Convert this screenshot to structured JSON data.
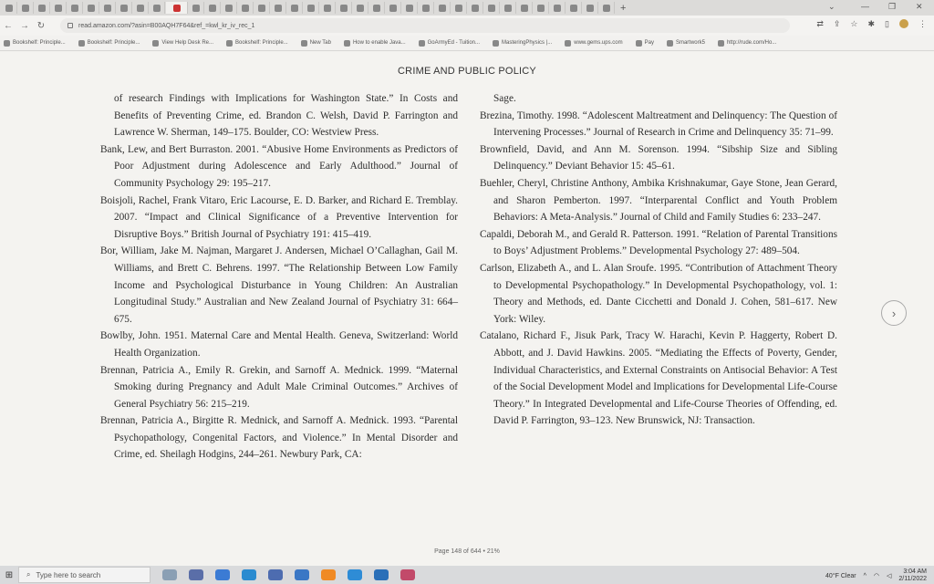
{
  "browser": {
    "tab_count": 37,
    "url": "read.amazon.com/?asin=B00AQH7F64&ref_=kwl_kr_iv_rec_1",
    "bookmarks": [
      "Bookshelf: Principle...",
      "Bookshelf: Principle...",
      "View Help Desk Re...",
      "Bookshelf: Principle...",
      "New Tab",
      "How to enable Java...",
      "GoArmyEd - Tuition...",
      "MasteringPhysics |...",
      "www.gems.ups.com",
      "Pay",
      "Smartwork5",
      "http://rude.com/Ho..."
    ]
  },
  "reader": {
    "running_head": "CRIME AND PUBLIC POLICY",
    "page_indicator": "Page 148 of 644 • 21%",
    "left_column": [
      {
        "cont": true,
        "text": "of research Findings with Implications for Washington State.” In Costs and Benefits of Preventing Crime, ed. Brandon C. Welsh, David P. Farrington and Lawrence W. Sherman, 149–175. Boulder, CO: Westview Press."
      },
      {
        "cont": false,
        "text": "Bank, Lew, and Bert Burraston. 2001. “Abusive Home Environments as Predictors of Poor Adjustment during Adolescence and Early Adulthood.” Journal of Community Psychology 29: 195–217."
      },
      {
        "cont": false,
        "text": "Boisjoli, Rachel, Frank Vitaro, Eric Lacourse, E. D. Barker, and Richard E. Tremblay. 2007. “Impact and Clinical Significance of a Preventive Intervention for Disruptive Boys.” British Journal of Psychiatry 191: 415–419."
      },
      {
        "cont": false,
        "text": "Bor, William, Jake M. Najman, Margaret J. Andersen, Michael O’Callaghan, Gail M. Williams, and Brett C. Behrens. 1997. “The Relationship Between Low Family Income and Psychological Disturbance in Young Children: An Australian Longitudinal Study.” Australian and New Zealand Journal of Psychiatry 31: 664–675."
      },
      {
        "cont": false,
        "text": "Bowlby, John. 1951. Maternal Care and Mental Health. Geneva, Switzerland: World Health Organization."
      },
      {
        "cont": false,
        "text": "Brennan, Patricia A., Emily R. Grekin, and Sarnoff A. Mednick. 1999. “Maternal Smoking during Pregnancy and Adult Male Criminal Outcomes.” Archives of General Psychiatry 56: 215–219."
      },
      {
        "cont": false,
        "text": "Brennan, Patricia A., Birgitte R. Mednick, and Sarnoff A. Mednick. 1993. “Parental Psychopathology, Congenital Factors, and Violence.” In Mental Disorder and Crime, ed. Sheilagh Hodgins, 244–261. Newbury Park, CA:"
      }
    ],
    "right_column": [
      {
        "cont": true,
        "text": "Sage."
      },
      {
        "cont": false,
        "text": "Brezina, Timothy. 1998. “Adolescent Maltreatment and Delinquency: The Question of Intervening Processes.” Journal of Research in Crime and Delinquency 35: 71–99."
      },
      {
        "cont": false,
        "text": "Brownfield, David, and Ann M. Sorenson. 1994. “Sibship Size and Sibling Delinquency.” Deviant Behavior 15: 45–61."
      },
      {
        "cont": false,
        "text": "Buehler, Cheryl, Christine Anthony, Ambika Krishnakumar, Gaye Stone, Jean Gerard, and Sharon Pemberton. 1997. “Interparental Conflict and Youth Problem Behaviors: A Meta-Analysis.” Journal of Child and Family Studies 6: 233–247."
      },
      {
        "cont": false,
        "text": "Capaldi, Deborah M., and Gerald R. Patterson. 1991. “Relation of Parental Transitions to Boys’ Adjustment Problems.” Developmental Psychology 27: 489–504."
      },
      {
        "cont": false,
        "text": "Carlson, Elizabeth A., and L. Alan Sroufe. 1995. “Contribution of Attachment Theory to Developmental Psychopathology.” In Developmental Psychopathology, vol. 1: Theory and Methods, ed. Dante Cicchetti and Donald J. Cohen, 581–617. New York: Wiley."
      },
      {
        "cont": false,
        "text": "Catalano, Richard F., Jisuk Park, Tracy W. Harachi, Kevin P. Haggerty, Robert D. Abbott, and J. David Hawkins. 2005. “Mediating the Effects of Poverty, Gender, Individual Characteristics, and External Constraints on Antisocial Behavior: A Test of the Social Development Model and Implications for Developmental Life-Course Theory.” In Integrated Developmental and Life-Course Theories of Offending, ed. David P. Farrington, 93–123. New Brunswick, NJ: Transaction."
      }
    ]
  },
  "taskbar": {
    "search_placeholder": "Type here to search",
    "weather": "40°F  Clear",
    "time": "3:04 AM",
    "date": "2/11/2022"
  },
  "colors": {
    "page_bg": "#f4f3f0",
    "text": "#2c2c2c",
    "taskbar": "#d9dadc"
  }
}
